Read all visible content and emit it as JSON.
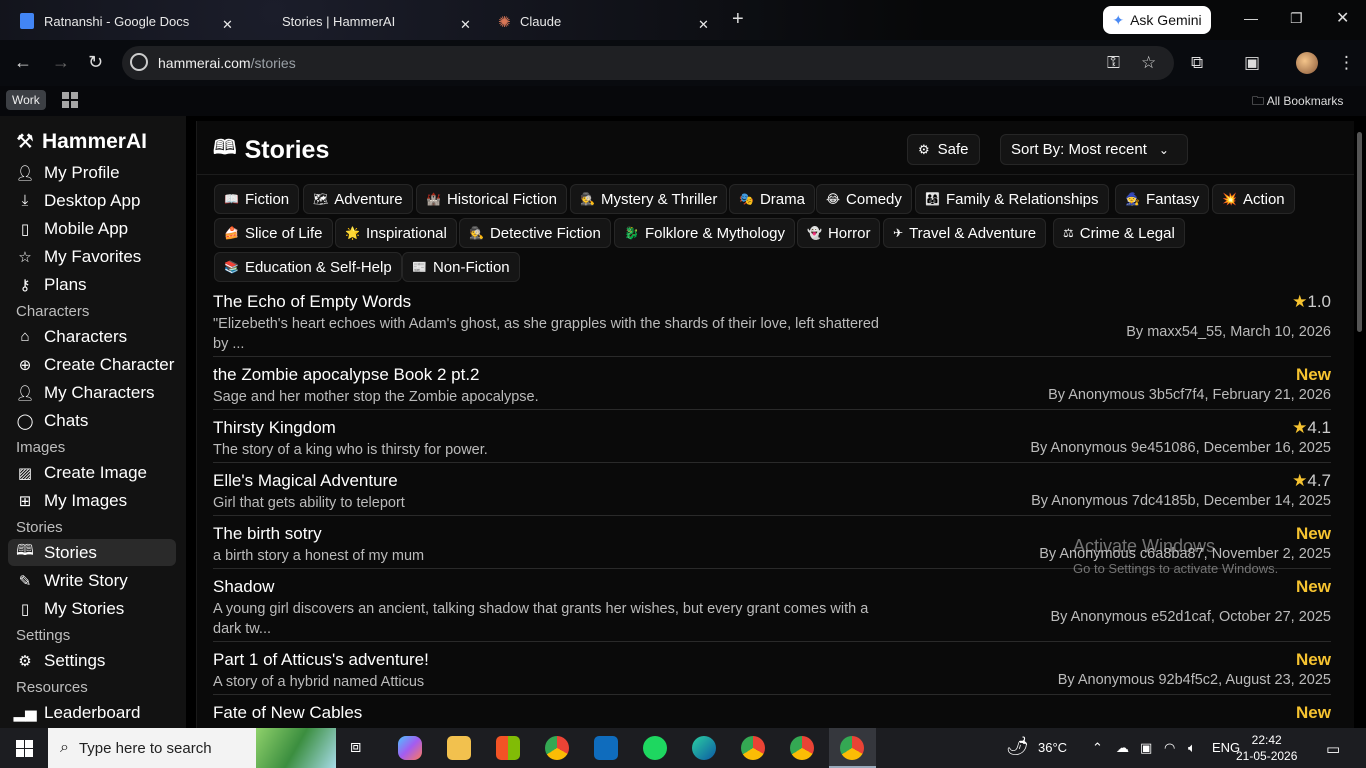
{
  "browser": {
    "tabs": [
      {
        "title": "Ratnanshi - Google Docs",
        "color": "#4285f4"
      },
      {
        "title": "Stories | HammerAI",
        "color": "#222222"
      },
      {
        "title": "Claude",
        "color": "#d97757"
      }
    ],
    "ask_gemini": "Ask Gemini",
    "url_host": "hammerai.com",
    "url_path": "/stories",
    "bookmark_work": "Work",
    "all_bookmarks": "All Bookmarks"
  },
  "sidebar": {
    "logo": "HammerAI",
    "items_top": [
      "My Profile",
      "Desktop App",
      "Mobile App",
      "My Favorites",
      "Plans"
    ],
    "sections": [
      {
        "heading": "Characters",
        "items": [
          "Characters",
          "Create Character",
          "My Characters",
          "Chats"
        ]
      },
      {
        "heading": "Images",
        "items": [
          "Create Image",
          "My Images"
        ]
      },
      {
        "heading": "Stories",
        "items": [
          "Stories",
          "Write Story",
          "My Stories"
        ]
      },
      {
        "heading": "Settings",
        "items": [
          "Settings"
        ]
      },
      {
        "heading": "Resources",
        "items": [
          "Leaderboard"
        ]
      }
    ]
  },
  "main": {
    "title": "Stories",
    "safe_label": "Safe",
    "sort_label": "Sort By: Most recent",
    "genres": [
      {
        "icon": "📖",
        "label": "Fiction"
      },
      {
        "icon": "🗺",
        "label": "Adventure"
      },
      {
        "icon": "🏰",
        "label": "Historical Fiction"
      },
      {
        "icon": "🕵",
        "label": "Mystery & Thriller"
      },
      {
        "icon": "🎭",
        "label": "Drama"
      },
      {
        "icon": "😂",
        "label": "Comedy"
      },
      {
        "icon": "👨‍👩‍👧",
        "label": "Family & Relationships"
      },
      {
        "icon": "🧙",
        "label": "Fantasy"
      },
      {
        "icon": "💥",
        "label": "Action"
      },
      {
        "icon": "🍰",
        "label": "Slice of Life"
      },
      {
        "icon": "🌟",
        "label": "Inspirational"
      },
      {
        "icon": "🕵",
        "label": "Detective Fiction"
      },
      {
        "icon": "🐉",
        "label": "Folklore & Mythology"
      },
      {
        "icon": "👻",
        "label": "Horror"
      },
      {
        "icon": "✈",
        "label": "Travel & Adventure"
      },
      {
        "icon": "⚖",
        "label": "Crime & Legal"
      },
      {
        "icon": "📚",
        "label": "Education & Self-Help"
      },
      {
        "icon": "📰",
        "label": "Non-Fiction"
      }
    ],
    "stories": [
      {
        "title": "The Echo of Empty Words",
        "desc": "\"Elizebeth's heart echoes with Adam's ghost, as she grapples with the shards of their love, left shattered by ...",
        "rating": "1.0",
        "is_new": false,
        "byline": "By maxx54_55, March 10, 2026"
      },
      {
        "title": "the Zombie apocalypse Book 2 pt.2",
        "desc": "Sage and her mother stop the Zombie apocalypse.",
        "rating": "New",
        "is_new": true,
        "byline": "By Anonymous 3b5cf7f4, February 21, 2026"
      },
      {
        "title": "Thirsty Kingdom",
        "desc": "The story of a king who is thirsty for power.",
        "rating": "4.1",
        "is_new": false,
        "byline": "By Anonymous 9e451086, December 16, 2025"
      },
      {
        "title": "Elle's Magical Adventure",
        "desc": "Girl that gets ability to teleport",
        "rating": "4.7",
        "is_new": false,
        "byline": "By Anonymous 7dc4185b, December 14, 2025"
      },
      {
        "title": "The birth sotry",
        "desc": "a birth story a honest of my mum",
        "rating": "New",
        "is_new": true,
        "byline": "By Anonymous c6a8ba87, November 2, 2025"
      },
      {
        "title": "Shadow",
        "desc": "A young girl discovers an ancient, talking shadow that grants her wishes, but every grant comes with a dark tw...",
        "rating": "New",
        "is_new": true,
        "byline": "By Anonymous e52d1caf, October 27, 2025"
      },
      {
        "title": "Part 1 of Atticus's adventure!",
        "desc": "A story of a hybrid named Atticus",
        "rating": "New",
        "is_new": true,
        "byline": "By Anonymous 92b4f5c2, August 23, 2025"
      },
      {
        "title": "Fate of New Cables",
        "desc": "",
        "rating": "New",
        "is_new": true,
        "byline": ""
      }
    ],
    "watermark_line1": "Activate Windows",
    "watermark_line2": "Go to Settings to activate Windows."
  },
  "taskbar": {
    "search_placeholder": "Type here to search",
    "temperature": "36°C",
    "language": "ENG",
    "time": "22:42",
    "date": "21-05-2026"
  }
}
